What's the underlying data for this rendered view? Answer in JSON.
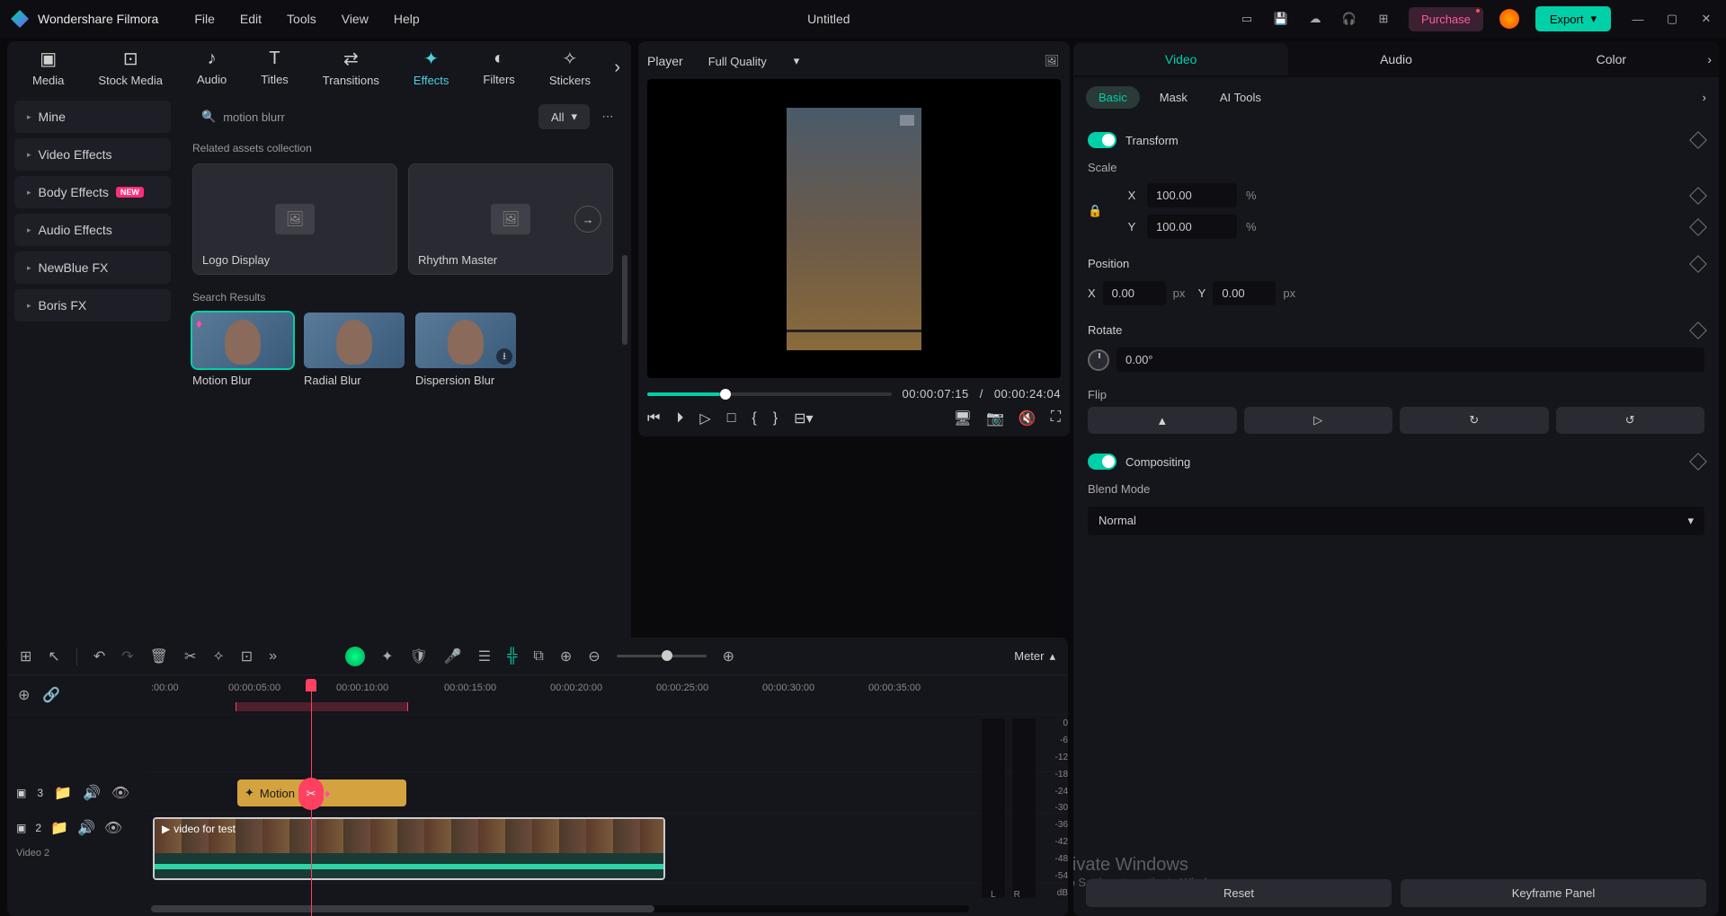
{
  "app": {
    "name": "Wondershare Filmora",
    "title": "Untitled"
  },
  "menu": [
    "File",
    "Edit",
    "Tools",
    "View",
    "Help"
  ],
  "titlebar": {
    "purchase": "Purchase",
    "export": "Export"
  },
  "categories": [
    "Media",
    "Stock Media",
    "Audio",
    "Titles",
    "Transitions",
    "Effects",
    "Filters",
    "Stickers"
  ],
  "active_category": "Effects",
  "sidebar": {
    "items": [
      {
        "label": "Mine",
        "badge": null
      },
      {
        "label": "Video Effects",
        "badge": null
      },
      {
        "label": "Body Effects",
        "badge": "NEW"
      },
      {
        "label": "Audio Effects",
        "badge": null
      },
      {
        "label": "NewBlue FX",
        "badge": null
      },
      {
        "label": "Boris FX",
        "badge": null
      }
    ]
  },
  "search": {
    "query": "motion blurr",
    "filter": "All"
  },
  "related_label": "Related assets collection",
  "related": [
    "Logo Display",
    "Rhythm Master"
  ],
  "results_label": "Search Results",
  "results": [
    "Motion Blur",
    "Radial Blur",
    "Dispersion Blur"
  ],
  "player": {
    "label": "Player",
    "quality": "Full Quality",
    "current": "00:00:07:15",
    "sep": "/",
    "duration": "00:00:24:04"
  },
  "props": {
    "tabs": [
      "Video",
      "Audio",
      "Color"
    ],
    "active_tab": "Video",
    "subtabs": [
      "Basic",
      "Mask",
      "AI Tools"
    ],
    "active_subtab": "Basic",
    "transform": "Transform",
    "scale": {
      "label": "Scale",
      "x": "100.00",
      "y": "100.00",
      "unit": "%"
    },
    "position": {
      "label": "Position",
      "x": "0.00",
      "y": "0.00",
      "unit": "px"
    },
    "rotate": {
      "label": "Rotate",
      "value": "0.00°"
    },
    "flip": "Flip",
    "compositing": "Compositing",
    "blend": {
      "label": "Blend Mode",
      "value": "Normal"
    },
    "footer": {
      "reset": "Reset",
      "keyframe": "Keyframe Panel"
    }
  },
  "timeline": {
    "meter": "Meter",
    "ticks": [
      ":00:00",
      "00:00:05:00",
      "00:00:10:00",
      "00:00:15:00",
      "00:00:20:00",
      "00:00:25:00",
      "00:00:30:00",
      "00:00:35:00"
    ],
    "tracks": {
      "effect": {
        "num": "3",
        "clip": "Motion Blur"
      },
      "video": {
        "num": "2",
        "label": "Video 2",
        "clip": "video for test"
      }
    },
    "meter_scale": [
      "0",
      "-6",
      "-12",
      "-18",
      "-24",
      "-30",
      "-36",
      "-42",
      "-48",
      "-54"
    ],
    "meter_unit": "dB",
    "lr": [
      "L",
      "R"
    ]
  },
  "watermark": {
    "title": "Activate Windows",
    "sub": "Go to Settings to activate Windows."
  }
}
